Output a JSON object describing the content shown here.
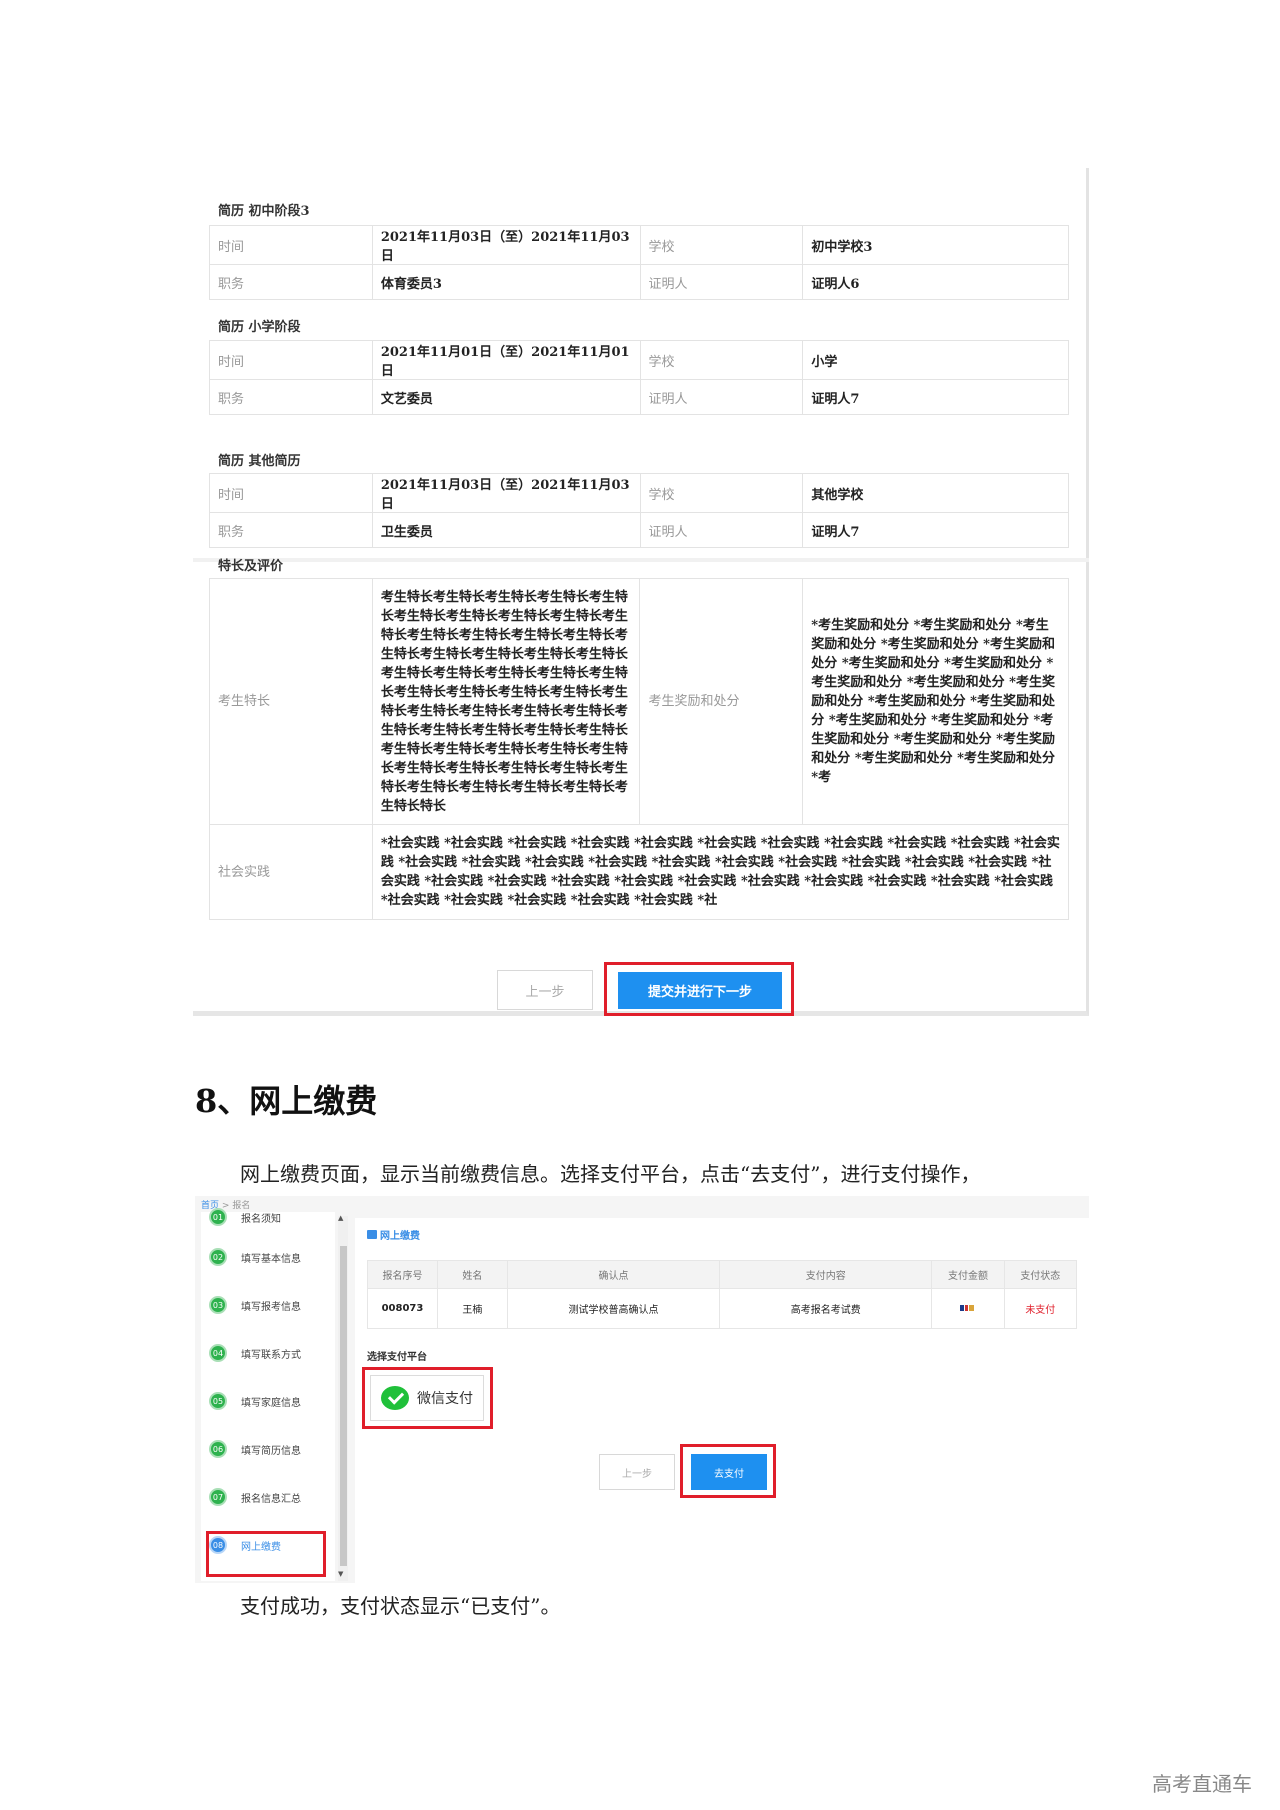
{
  "resume_sections": [
    {
      "title": "简历 初中阶段3",
      "rows": [
        {
          "l1": "时间",
          "v1": "2021年11月03日（至）2021年11月03日",
          "l2": "学校",
          "v2": "初中学校3"
        },
        {
          "l1": "职务",
          "v1": "体育委员3",
          "l2": "证明人",
          "v2": "证明人6"
        }
      ]
    },
    {
      "title": "简历 小学阶段",
      "rows": [
        {
          "l1": "时间",
          "v1": "2021年11月01日（至）2021年11月01日",
          "l2": "学校",
          "v2": "小学"
        },
        {
          "l1": "职务",
          "v1": "文艺委员",
          "l2": "证明人",
          "v2": "证明人7"
        }
      ]
    },
    {
      "title": "简历 其他简历",
      "rows": [
        {
          "l1": "时间",
          "v1": "2021年11月03日（至）2021年11月03日",
          "l2": "学校",
          "v2": "其他学校"
        },
        {
          "l1": "职务",
          "v1": "卫生委员",
          "l2": "证明人",
          "v2": "证明人7"
        }
      ]
    }
  ],
  "evaluation": {
    "title": "特长及评价",
    "specialty_label": "考生特长",
    "specialty_value": "考生特长考生特长考生特长考生特长考生特长考生特长考生特长考生特长考生特长考生特长考生特长考生特长考生特长考生特长考生特长考生特长考生特长考生特长考生特长考生特长考生特长考生特长考生特长考生特长考生特长考生特长考生特长考生特长考生特长考生特长考生特长考生特长考生特长考生特长考生特长考生特长考生特长考生特长考生特长考生特长考生特长考生特长考生特长考生特长考生特长考生特长考生特长考生特长考生特长考生特长考生特长考生特长考生特长特长",
    "award_label": "考生奖励和处分",
    "award_value": "*考生奖励和处分 *考生奖励和处分 *考生奖励和处分 *考生奖励和处分 *考生奖励和处分 *考生奖励和处分 *考生奖励和处分 *考生奖励和处分 *考生奖励和处分 *考生奖励和处分 *考生奖励和处分 *考生奖励和处分 *考生奖励和处分 *考生奖励和处分 *考生奖励和处分 *考生奖励和处分 *考生奖励和处分 *考生奖励和处分 *考生奖励和处分 *考",
    "practice_label": "社会实践",
    "practice_value": "*社会实践 *社会实践 *社会实践 *社会实践 *社会实践 *社会实践 *社会实践 *社会实践 *社会实践 *社会实践 *社会实践 *社会实践 *社会实践 *社会实践 *社会实践 *社会实践 *社会实践 *社会实践 *社会实践 *社会实践 *社会实践 *社会实践 *社会实践 *社会实践 *社会实践 *社会实践 *社会实践 *社会实践 *社会实践 *社会实践 *社会实践 *社会实践 *社会实践 *社会实践 *社会实践 *社会实践 *社会实践 *社"
  },
  "form_buttons": {
    "prev": "上一步",
    "submit": "提交并进行下一步"
  },
  "section_heading": "8、网上缴费",
  "para1": "网上缴费页面，显示当前缴费信息。选择支付平台，点击“去支付”，进行支付操作，",
  "para2": "支付成功，支付状态显示“已支付”。",
  "payment_page": {
    "breadcrumb_home": "首页",
    "breadcrumb_sep": ">",
    "breadcrumb_current": "报名",
    "steps": [
      {
        "num": "01",
        "label": "报名须知"
      },
      {
        "num": "02",
        "label": "填写基本信息"
      },
      {
        "num": "03",
        "label": "填写报考信息"
      },
      {
        "num": "04",
        "label": "填写联系方式"
      },
      {
        "num": "05",
        "label": "填写家庭信息"
      },
      {
        "num": "06",
        "label": "填写简历信息"
      },
      {
        "num": "07",
        "label": "报名信息汇总"
      },
      {
        "num": "08",
        "label": "网上缴费"
      }
    ],
    "panel_title": "网上缴费",
    "table_headers": [
      "报名序号",
      "姓名",
      "确认点",
      "支付内容",
      "支付金额",
      "支付状态"
    ],
    "table_row": {
      "seq": "008073",
      "name": "王楠",
      "point": "测试学校普高确认点",
      "content": "高考报名考试费",
      "status": "未支付"
    },
    "platform_label": "选择支付平台",
    "wechat_label": "微信支付",
    "prev": "上一步",
    "pay": "去支付"
  },
  "watermark": "高考直通车",
  "colors": {
    "primary": "#1e90f0",
    "highlight": "#e01e2a",
    "step_green": "#2eb24e",
    "wechat_green": "#20c03a"
  }
}
